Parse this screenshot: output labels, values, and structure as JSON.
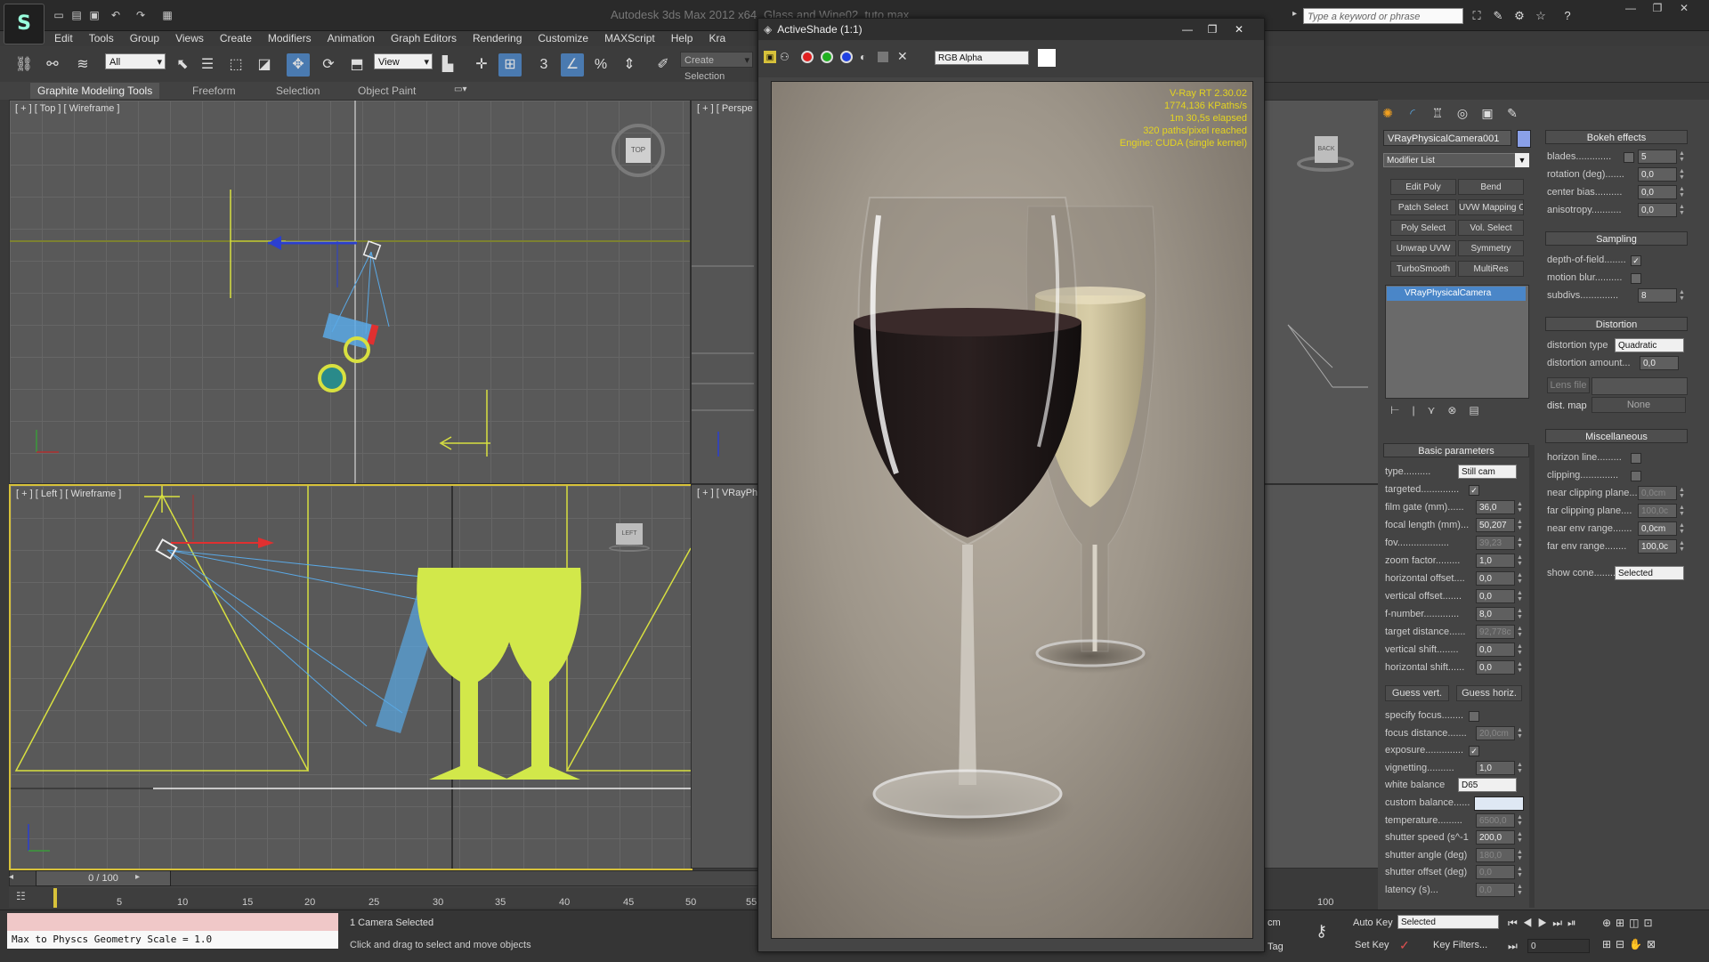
{
  "titlebar": {
    "app_title": "Autodesk 3ds Max 2012 x64",
    "doc_title": "Glass and Wine02_tuto.max",
    "search_placeholder": "Type a keyword or phrase"
  },
  "menu": [
    "Edit",
    "Tools",
    "Group",
    "Views",
    "Create",
    "Modifiers",
    "Animation",
    "Graph Editors",
    "Rendering",
    "Customize",
    "MAXScript",
    "Help",
    "Kra"
  ],
  "toolbar": {
    "selection_filter": "All",
    "ref_coord": "View",
    "create_selection": "Create Selection",
    "snap_toggle": "3"
  },
  "ribbon_tabs": [
    "Graphite Modeling Tools",
    "Freeform",
    "Selection",
    "Object Paint"
  ],
  "viewports": {
    "top_label": "[ + ] [ Top ] [ Wireframe ]",
    "persp_label": "[ + ] [ Perspe",
    "left_label": "[ + ] [ Left ] [ Wireframe ]",
    "vray_label": "[ + ] [ VRayPh",
    "viewcube_top": "TOP",
    "viewcube_left": "LEFT",
    "viewcube_back": "BACK"
  },
  "timeline": {
    "frame": "0 / 100",
    "ticks": [
      "5",
      "10",
      "15",
      "20",
      "25",
      "30",
      "35",
      "40",
      "45",
      "50",
      "55",
      "100"
    ]
  },
  "status": {
    "maxscript_input": "Max to Physcs Geometry Scale = 1.0",
    "selection": "1 Camera Selected",
    "prompt": "Click and drag to select and move objects",
    "units_fragment": "cm",
    "add_tag": "Tag"
  },
  "activeshade": {
    "title": "ActiveShade (1:1)",
    "channel": "RGB Alpha",
    "info": [
      "V-Ray RT 2.30.02",
      "1774,136 KPaths/s",
      "1m 30,5s elapsed",
      "320 paths/pixel reached",
      "Engine: CUDA (single kernel)"
    ]
  },
  "command_panel": {
    "object_name": "VRayPhysicalCamera001",
    "modifier_list": "Modifier List",
    "modifier_buttons": [
      "Edit Poly",
      "Bend",
      "Patch Select",
      "UVW Mapping Cle",
      "Poly Select",
      "Vol. Select",
      "Unwrap UVW",
      "Symmetry",
      "TurboSmooth",
      "MultiRes"
    ],
    "stack_item": "VRayPhysicalCamera",
    "basic_title": "Basic parameters",
    "basic": [
      {
        "label": "type..........",
        "value": "Still cam",
        "kind": "dropdown"
      },
      {
        "label": "targeted..............",
        "value": "✓",
        "kind": "check"
      },
      {
        "label": "film gate (mm)......",
        "value": "36,0",
        "kind": "spinner"
      },
      {
        "label": "focal length (mm)...",
        "value": "50,207",
        "kind": "spinner"
      },
      {
        "label": "fov...................",
        "value": "39,23",
        "kind": "spinner-dim"
      },
      {
        "label": "zoom factor.........",
        "value": "1,0",
        "kind": "spinner"
      },
      {
        "label": "horizontal offset....",
        "value": "0,0",
        "kind": "spinner"
      },
      {
        "label": "vertical offset.......",
        "value": "0,0",
        "kind": "spinner"
      },
      {
        "label": "f-number.............",
        "value": "8,0",
        "kind": "spinner"
      },
      {
        "label": "target distance......",
        "value": "92,778c",
        "kind": "spinner-dim"
      },
      {
        "label": "vertical shift........",
        "value": "0,0",
        "kind": "spinner"
      },
      {
        "label": "horizontal shift......",
        "value": "0,0",
        "kind": "spinner"
      }
    ],
    "guess_vert": "Guess vert.",
    "guess_horiz": "Guess horiz.",
    "basic2": [
      {
        "label": "specify focus........",
        "value": "",
        "kind": "check"
      },
      {
        "label": "focus distance.......",
        "value": "20,0cm",
        "kind": "spinner-dim"
      },
      {
        "label": "exposure..............",
        "value": "✓",
        "kind": "check"
      },
      {
        "label": "vignetting..........",
        "value": "1,0",
        "kind": "spinner"
      },
      {
        "label": "white balance",
        "value": "D65",
        "kind": "dropdown"
      },
      {
        "label": "custom balance......",
        "value": "",
        "kind": "swatch"
      },
      {
        "label": "temperature.........",
        "value": "6500,0",
        "kind": "spinner-dim"
      },
      {
        "label": "shutter speed (s^-1",
        "value": "200,0",
        "kind": "spinner"
      },
      {
        "label": "shutter angle (deg)",
        "value": "180,0",
        "kind": "spinner-dim"
      },
      {
        "label": "shutter offset (deg)",
        "value": "0,0",
        "kind": "spinner-dim"
      },
      {
        "label": "latency (s)...",
        "value": "0,0",
        "kind": "spinner-dim"
      }
    ],
    "bokeh_title": "Bokeh effects",
    "bokeh": [
      {
        "label": "blades.............",
        "value": "5",
        "kind": "check-spinner"
      },
      {
        "label": "rotation (deg).......",
        "value": "0,0",
        "kind": "spinner"
      },
      {
        "label": "center bias..........",
        "value": "0,0",
        "kind": "spinner"
      },
      {
        "label": "anisotropy...........",
        "value": "0,0",
        "kind": "spinner"
      }
    ],
    "sampling_title": "Sampling",
    "sampling": [
      {
        "label": "depth-of-field........",
        "value": "✓",
        "kind": "check"
      },
      {
        "label": "motion blur..........",
        "value": "",
        "kind": "check"
      },
      {
        "label": "subdivs..............",
        "value": "8",
        "kind": "spinner"
      }
    ],
    "distortion_title": "Distortion",
    "distortion_type_label": "distortion type",
    "distortion_type": "Quadratic",
    "distortion_amount_label": "distortion amount...",
    "distortion_amount": "0,0",
    "lens_file": "Lens file",
    "dist_map": "dist. map",
    "dist_map_value": "None",
    "misc_title": "Miscellaneous",
    "misc": [
      {
        "label": "horizon line.........",
        "value": "",
        "kind": "check"
      },
      {
        "label": "clipping..............",
        "value": "",
        "kind": "check"
      },
      {
        "label": "near clipping plane...",
        "value": "0,0cm",
        "kind": "spinner-dim"
      },
      {
        "label": "far clipping plane....",
        "value": "100,0c",
        "kind": "spinner-dim"
      },
      {
        "label": "near env range.......",
        "value": "0,0cm",
        "kind": "spinner"
      },
      {
        "label": "far env range........",
        "value": "100,0c",
        "kind": "spinner"
      }
    ],
    "show_cone_label": "show cone...........",
    "show_cone": "Selected"
  },
  "anim_controls": {
    "auto_key": "Auto Key",
    "set_key": "Set Key",
    "selected": "Selected",
    "key_filters": "Key Filters...",
    "frame_field": "0"
  },
  "colors": {
    "accent": "#4a7ab0",
    "wireframe_yellow": "#d8e040",
    "camera_blue": "#5aa9e6",
    "info_yellow": "#e4d420"
  }
}
